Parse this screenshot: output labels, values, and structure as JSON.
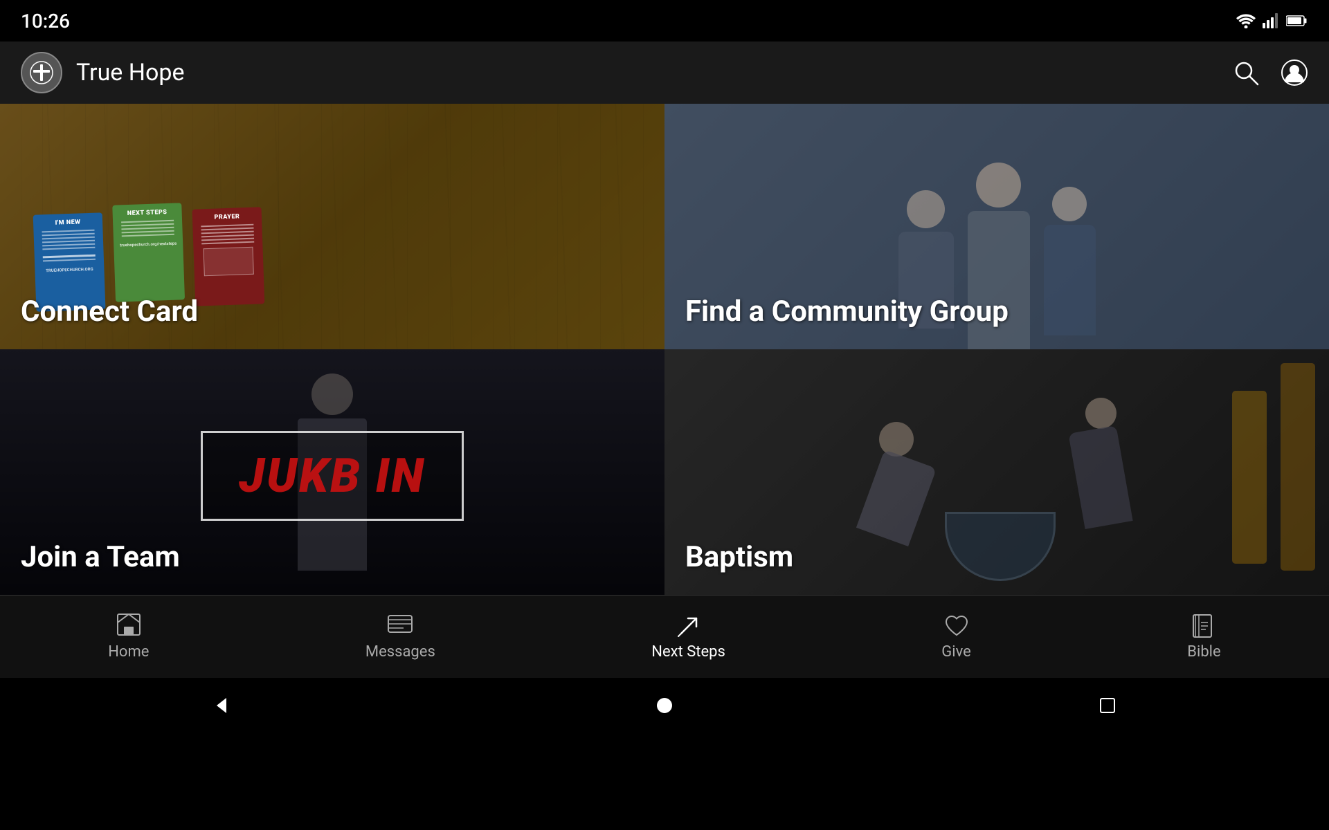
{
  "statusBar": {
    "time": "10:26"
  },
  "appBar": {
    "title": "True Hope",
    "logoAlt": "True Hope Church Logo"
  },
  "grid": {
    "items": [
      {
        "id": "connect-card",
        "label": "Connect Card",
        "position": "top-left"
      },
      {
        "id": "community-group",
        "label": "Find a Community Group",
        "position": "top-right"
      },
      {
        "id": "join-team",
        "label": "Join a Team",
        "position": "bottom-left"
      },
      {
        "id": "baptism",
        "label": "Baptism",
        "position": "bottom-right"
      }
    ],
    "cards": {
      "blue": {
        "title": "I'M NEW"
      },
      "green": {
        "title": "NEXT STEPS"
      },
      "red": {
        "title": "PRAYER"
      }
    },
    "joinTeamText": "JUKB IN"
  },
  "bottomNav": {
    "items": [
      {
        "id": "home",
        "label": "Home",
        "icon": "home-icon",
        "active": false
      },
      {
        "id": "messages",
        "label": "Messages",
        "icon": "messages-icon",
        "active": false
      },
      {
        "id": "next-steps",
        "label": "Next Steps",
        "icon": "next-steps-icon",
        "active": true
      },
      {
        "id": "give",
        "label": "Give",
        "icon": "give-icon",
        "active": false
      },
      {
        "id": "bible",
        "label": "Bible",
        "icon": "bible-icon",
        "active": false
      }
    ]
  },
  "systemNav": {
    "back": "◀",
    "home": "●",
    "recent": "■"
  }
}
